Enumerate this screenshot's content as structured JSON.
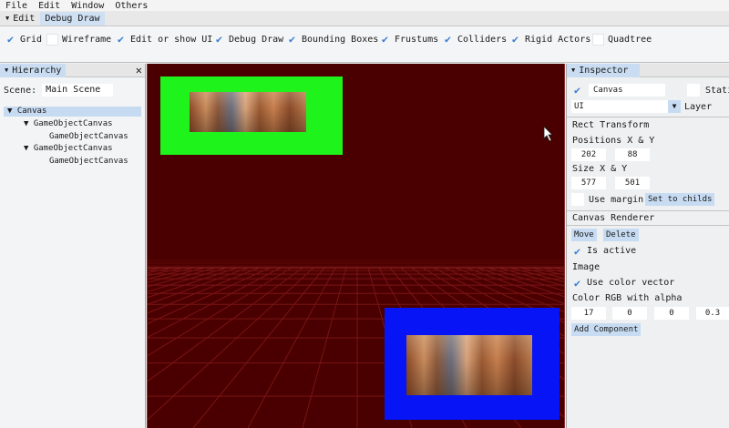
{
  "menu": {
    "items": [
      "File",
      "Edit",
      "Window",
      "Others"
    ]
  },
  "tabs": [
    {
      "label": "Edit",
      "active": false
    },
    {
      "label": "Debug Draw",
      "active": true
    }
  ],
  "toolbar": {
    "items": [
      {
        "label": "Grid",
        "checked": true
      },
      {
        "label": "Wireframe",
        "checked": false
      },
      {
        "label": "Edit or show UI",
        "checked": true
      },
      {
        "label": "Debug Draw",
        "checked": true
      },
      {
        "label": "Bounding Boxes",
        "checked": true
      },
      {
        "label": "Frustums",
        "checked": true
      },
      {
        "label": "Colliders",
        "checked": true
      },
      {
        "label": "Rigid Actors",
        "checked": true
      },
      {
        "label": "Quadtree",
        "checked": false
      }
    ]
  },
  "hierarchy": {
    "title": "Hierarchy",
    "scene_label": "Scene:",
    "scene_value": "Main Scene",
    "tree": [
      {
        "label": "Canvas",
        "expanded": true,
        "selected": true
      },
      {
        "label": "GameObjectCanvas",
        "expanded": true
      },
      {
        "label": "GameObjectCanvas"
      },
      {
        "label": "GameObjectCanvas",
        "expanded": true
      },
      {
        "label": "GameObjectCanvas"
      }
    ]
  },
  "inspector": {
    "title": "Inspector",
    "name_value": "Canvas",
    "static_label": "Stati",
    "tag_value": "UI",
    "layer_label": "Layer",
    "rect_transform_label": "Rect Transform",
    "positions_label": "Positions X & Y",
    "pos_x": "202",
    "pos_y": "88",
    "size_label": "Size X & Y",
    "size_x": "577",
    "size_y": "501",
    "use_margin_label": "Use margin",
    "set_to_childs_label": "Set to childs",
    "canvas_renderer_label": "Canvas Renderer",
    "move_label": "Move",
    "delete_label": "Delete",
    "is_active_label": "Is active",
    "image_label": "Image",
    "use_color_vector_label": "Use color vector",
    "color_label": "Color RGB with alpha",
    "color_r": "17",
    "color_g": "0",
    "color_b": "0",
    "color_a": "0.3",
    "add_component_label": "Add Component"
  },
  "colors": {
    "viewport_bg": "#4a0000",
    "green_panel": "#1ef41c",
    "blue_panel": "#0614f6",
    "accent": "#3a7ed6",
    "selection": "#c6daf1"
  }
}
